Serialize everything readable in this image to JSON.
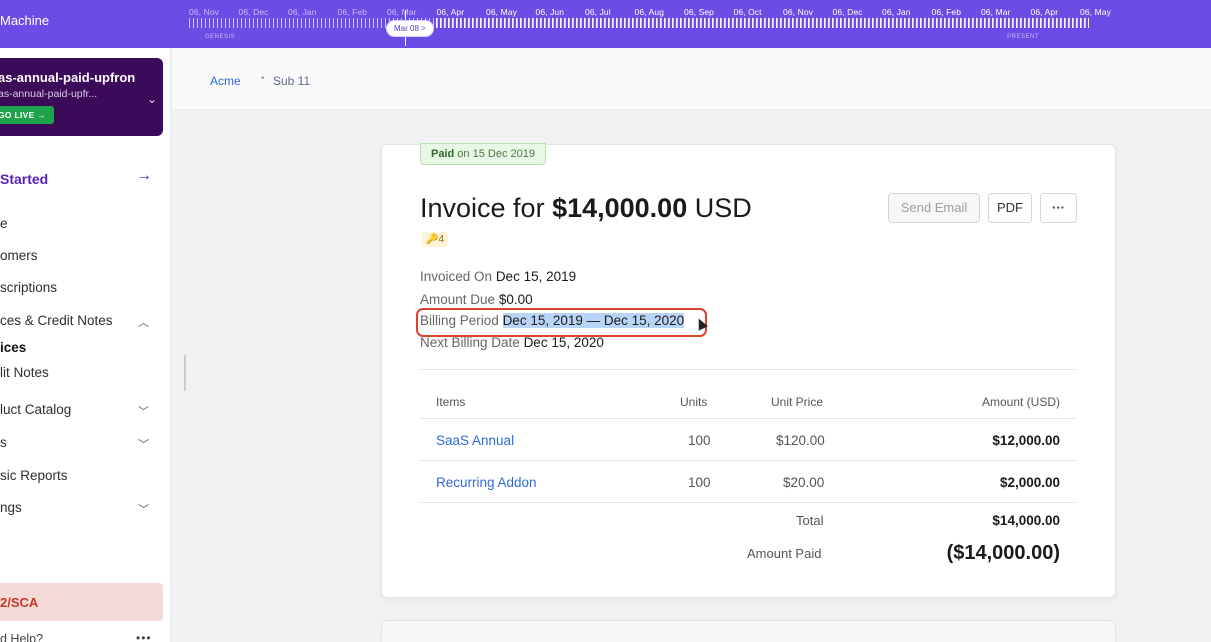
{
  "app": {
    "title": "Machine"
  },
  "timeline": {
    "months": [
      "06, Nov",
      "06, Dec",
      "06, Jan",
      "06, Feb",
      "06, Mar",
      "06, Apr",
      "06, May",
      "06, Jun",
      "06, Jul",
      "06, Aug",
      "06, Sep",
      "06, Oct",
      "06, Nov",
      "06, Dec",
      "06, Jan",
      "06, Feb",
      "06, Mar",
      "06, Apr",
      "06, May"
    ],
    "marker": "Mar 08 >",
    "genesis_label": "GENESIS",
    "present_label": "PRESENT"
  },
  "sidebar": {
    "account_name": "as-annual-paid-upfron",
    "account_sub": "as-annual-paid-upfr...",
    "go_live": "GO LIVE →",
    "get_started": "Started",
    "items": [
      {
        "label": "e"
      },
      {
        "label": "omers"
      },
      {
        "label": "scriptions"
      },
      {
        "label": "ces & Credit Notes"
      },
      {
        "label": "ices"
      },
      {
        "label": "lit Notes"
      },
      {
        "label": "luct Catalog"
      },
      {
        "label": "s"
      },
      {
        "label": "sic Reports"
      },
      {
        "label": "ngs"
      }
    ],
    "sca_label": "2/SCA",
    "help_label": "d Help?"
  },
  "breadcrumb": {
    "root": "Acme",
    "current": "Sub 11"
  },
  "invoice": {
    "paid_status": "Paid",
    "paid_date": "on 15 Dec 2019",
    "title_prefix": "Invoice for",
    "amount": "$14,000.00",
    "currency": "USD",
    "tag": "4",
    "buttons": {
      "send_email": "Send Email",
      "pdf": "PDF",
      "more": "···"
    },
    "invoiced_on_label": "Invoiced On",
    "invoiced_on": "Dec 15, 2019",
    "amount_due_label": "Amount Due",
    "amount_due": "$0.00",
    "billing_period_label": "Billing Period",
    "billing_period": "Dec 15, 2019 — Dec 15, 2020",
    "next_billing_label": "Next Billing Date",
    "next_billing": "Dec 15, 2020",
    "table": {
      "headers": {
        "items": "Items",
        "units": "Units",
        "unit_price": "Unit Price",
        "amount": "Amount (USD)"
      },
      "rows": [
        {
          "item": "SaaS Annual",
          "units": "100",
          "unit_price": "$120.00",
          "amount": "$12,000.00"
        },
        {
          "item": "Recurring Addon",
          "units": "100",
          "unit_price": "$20.00",
          "amount": "$2,000.00"
        }
      ],
      "total_label": "Total",
      "total": "$14,000.00",
      "amount_paid_label": "Amount Paid",
      "amount_paid": "($14,000.00)"
    }
  }
}
